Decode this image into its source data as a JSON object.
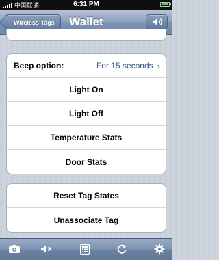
{
  "status_bar": {
    "carrier": "中国联通",
    "time": "6:31 PM"
  },
  "nav": {
    "back_label": "Wireless Tags",
    "title": "Wallet"
  },
  "group1": {
    "beep_label": "Beep option:",
    "beep_value": "For 15 seconds",
    "items": [
      "Light On",
      "Light Off",
      "Temperature Stats",
      "Door Stats"
    ]
  },
  "group2": {
    "items": [
      "Reset Tag States",
      "Unassociate Tag"
    ]
  },
  "toolbar": {
    "icons": [
      "camera-icon",
      "mute-icon",
      "calculator-icon",
      "refresh-icon",
      "gear-icon"
    ]
  },
  "colors": {
    "nav_bar": "#7e94b3",
    "detail_value": "#385487",
    "battery": "#37d84a"
  }
}
